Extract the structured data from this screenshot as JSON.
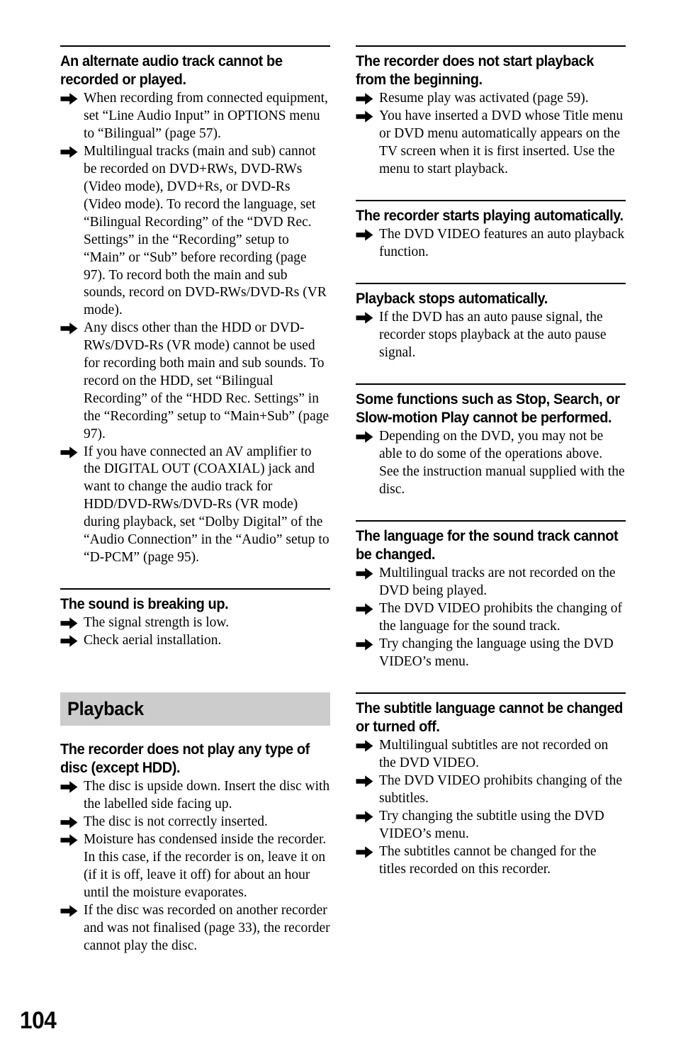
{
  "page": {
    "number": "104",
    "band_color": "#cccccc",
    "bullet_icon": "arrow-right-icon"
  },
  "left_column": {
    "blocks": [
      {
        "type": "topic",
        "has_rule": true,
        "heading": "An alternate audio track cannot be recorded or played.",
        "bullets": [
          "When recording from connected equipment, set “Line Audio Input” in OPTIONS menu to “Bilingual” (page 57).",
          "Multilingual tracks (main and sub) cannot be recorded on DVD+RWs, DVD-RWs (Video mode), DVD+Rs, or DVD-Rs (Video mode). To record the language, set “Bilingual Recording” of the “DVD Rec. Settings” in the “Recording” setup to “Main” or “Sub” before recording (page 97). To record both the main and sub sounds, record on DVD-RWs/DVD-Rs (VR mode).",
          "Any discs other than the HDD or DVD-RWs/DVD-Rs (VR mode) cannot be used for recording both main and sub sounds. To record on the HDD, set “Bilingual Recording” of the “HDD Rec. Settings” in the “Recording” setup to “Main+Sub” (page 97).",
          "If you have connected an AV amplifier to the DIGITAL OUT (COAXIAL) jack and want to change the audio track for HDD/DVD-RWs/DVD-Rs (VR mode) during playback, set “Dolby Digital” of the “Audio Connection” in the “Audio” setup to “D-PCM” (page 95)."
        ]
      },
      {
        "type": "topic",
        "has_rule": true,
        "heading": "The sound is breaking up.",
        "bullets": [
          "The signal strength is low.",
          "Check aerial installation."
        ]
      },
      {
        "type": "section",
        "title": "Playback"
      },
      {
        "type": "topic",
        "has_rule": false,
        "heading": "The recorder does not play any type of disc (except HDD).",
        "bullets": [
          "The disc is upside down. Insert the disc with the labelled side facing up.",
          "The disc is not correctly inserted.",
          "Moisture has condensed inside the recorder. In this case, if the recorder is on, leave it on (if it is off, leave it off) for about an hour until the moisture evaporates.",
          "If the disc was recorded on another recorder and was not finalised (page 33), the recorder cannot play the disc."
        ]
      }
    ]
  },
  "right_column": {
    "blocks": [
      {
        "type": "topic",
        "has_rule": true,
        "heading": "The recorder does not start playback from the beginning.",
        "bullets": [
          "Resume play was activated (page 59).",
          "You have inserted a DVD whose Title menu or DVD menu automatically appears on the TV screen when it is first inserted. Use the menu to start playback."
        ]
      },
      {
        "type": "topic",
        "has_rule": true,
        "heading": "The recorder starts playing automatically.",
        "bullets": [
          "The DVD VIDEO features an auto playback function."
        ]
      },
      {
        "type": "topic",
        "has_rule": true,
        "heading": "Playback stops automatically.",
        "bullets": [
          "If the DVD has an auto pause signal, the recorder stops playback at the auto pause signal."
        ]
      },
      {
        "type": "topic",
        "has_rule": true,
        "heading": "Some functions such as Stop, Search, or Slow-motion Play cannot be performed.",
        "bullets": [
          "Depending on the DVD, you may not be able to do some of the operations above. See the instruction manual supplied with the disc."
        ]
      },
      {
        "type": "topic",
        "has_rule": true,
        "heading": "The language for the sound track cannot be changed.",
        "bullets": [
          "Multilingual tracks are not recorded on the DVD being played.",
          "The DVD VIDEO prohibits the changing of the language for the sound track.",
          "Try changing the language using the DVD VIDEO’s menu."
        ]
      },
      {
        "type": "topic",
        "has_rule": true,
        "heading": "The subtitle language cannot be changed or turned off.",
        "bullets": [
          "Multilingual subtitles are not recorded on the DVD VIDEO.",
          "The DVD VIDEO prohibits changing of the subtitles.",
          "Try changing the subtitle using the DVD VIDEO’s menu.",
          "The subtitles cannot be changed for the titles recorded on this recorder."
        ]
      }
    ]
  }
}
